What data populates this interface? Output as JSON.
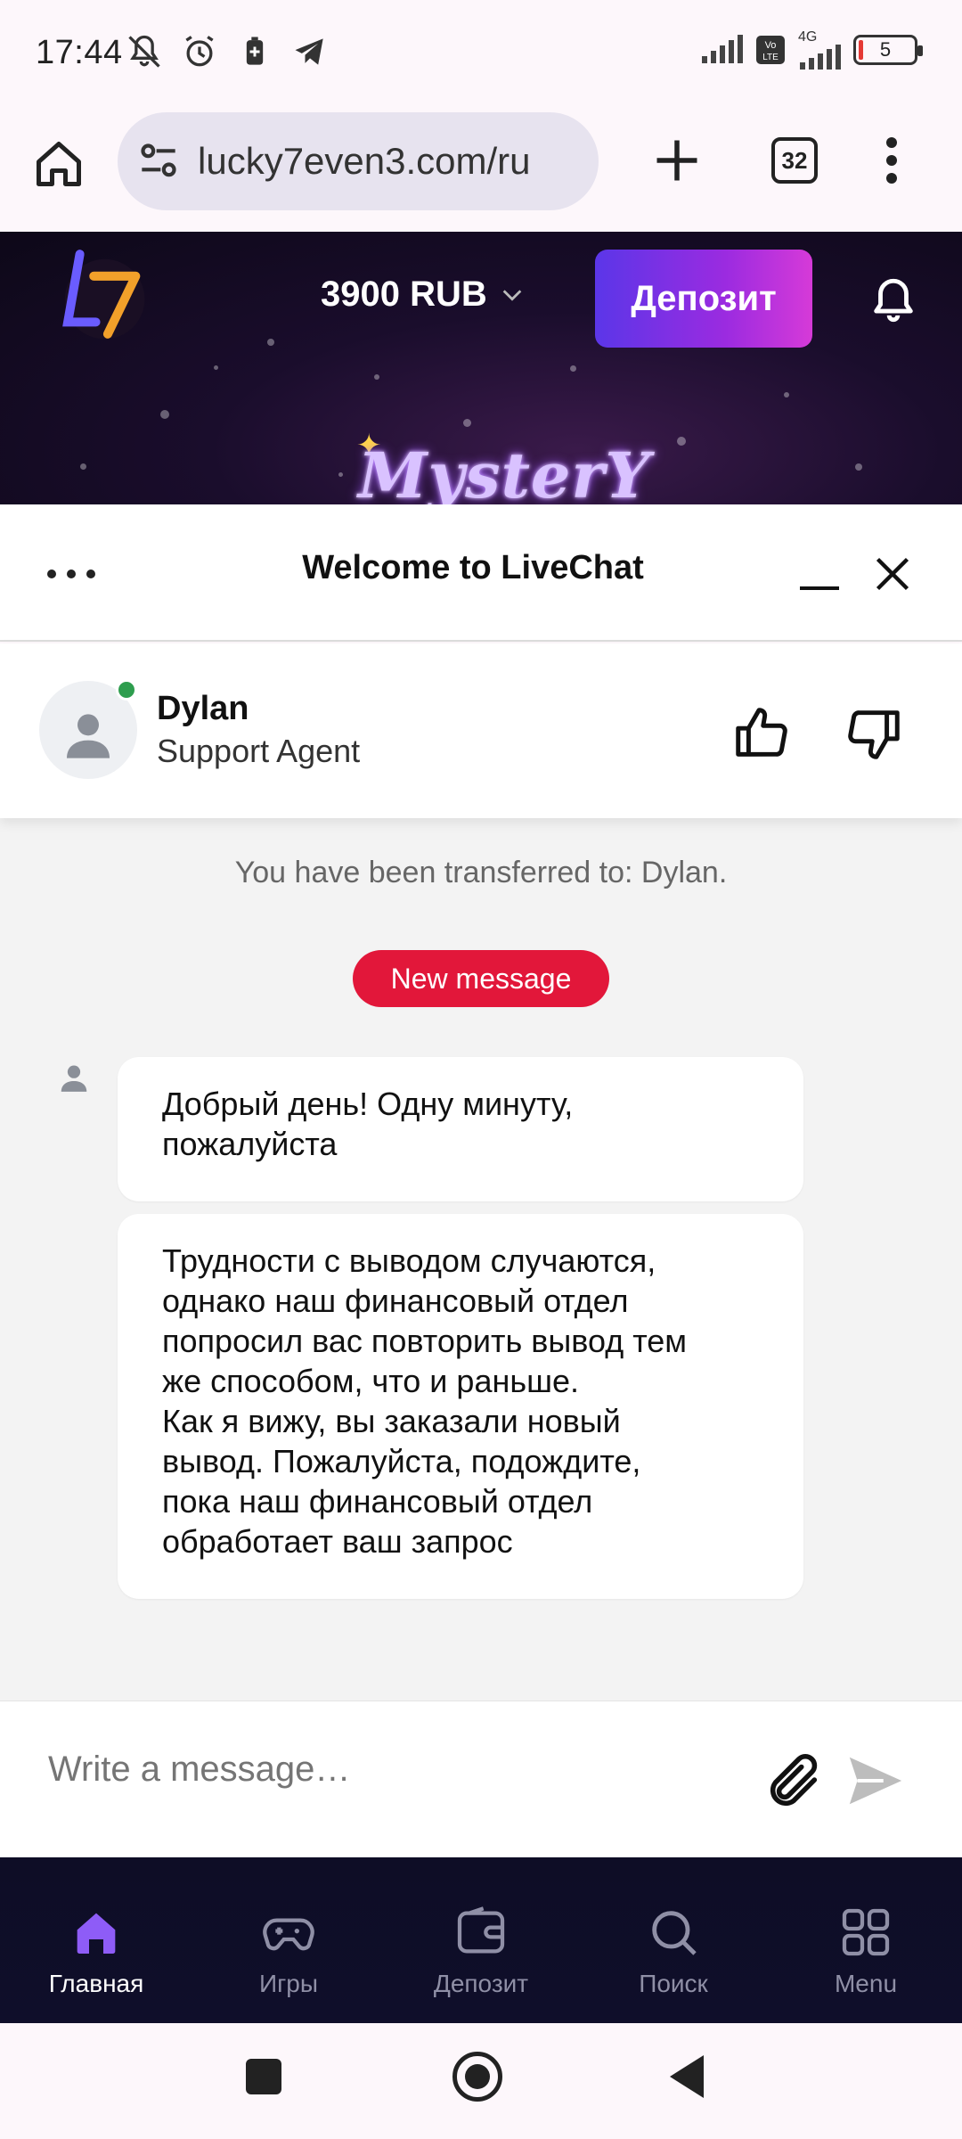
{
  "status_bar": {
    "time": "17:44",
    "network": "4G",
    "battery": "5"
  },
  "browser": {
    "url": "lucky7even3.com/ru",
    "tab_count": "32"
  },
  "site_header": {
    "balance": "3900 RUB",
    "deposit_label": "Депозит",
    "banner_text": "MysterY"
  },
  "chat": {
    "title": "Welcome to LiveChat",
    "agent": {
      "name": "Dylan",
      "role": "Support Agent",
      "online": true
    },
    "system_message": "You have been transferred to: Dylan.",
    "new_message_badge": "New message",
    "messages": [
      {
        "text": "Добрый день! Одну минуту,\nпожалуйста"
      },
      {
        "text": "Трудности с выводом случаются,\nоднако наш финансовый отдел\nпопросил вас повторить вывод тем\nже способом, что и раньше.\nКак я вижу, вы заказали новый\nвывод. Пожалуйста, подождите,\nпока наш финансовый отдел\nобработает ваш запрос"
      }
    ],
    "composer_placeholder": "Write a message…"
  },
  "bottom_nav": {
    "items": [
      {
        "label": "Главная",
        "icon": "home-icon",
        "active": true
      },
      {
        "label": "Игры",
        "icon": "gamepad-icon",
        "active": false
      },
      {
        "label": "Депозит",
        "icon": "wallet-icon",
        "active": false
      },
      {
        "label": "Поиск",
        "icon": "search-icon",
        "active": false
      },
      {
        "label": "Menu",
        "icon": "grid-icon",
        "active": false
      }
    ]
  },
  "colors": {
    "deposit_gradient_start": "#5b36e8",
    "deposit_gradient_end": "#d63ad8",
    "new_message_badge": "#e2173a",
    "online_dot": "#2e9d4e",
    "nav_active": "#8e5cf7"
  }
}
